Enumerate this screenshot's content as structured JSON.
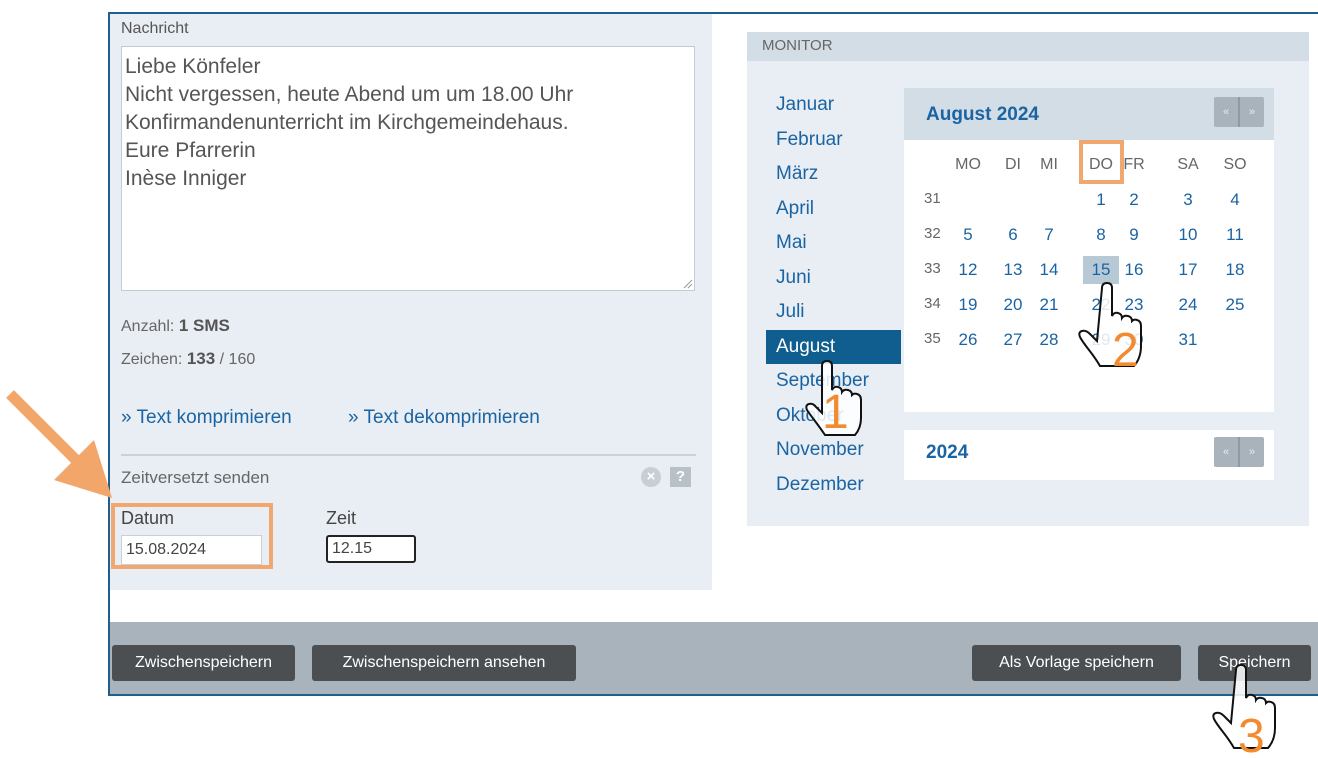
{
  "message": {
    "label": "Nachricht",
    "text": "Liebe Könfeler\nNicht vergessen, heute Abend um um 18.00 Uhr Konfirmandenunterricht im Kirchgemeindehaus.\nEure Pfarrerin\nInèse Inniger"
  },
  "stats": {
    "count_label": "Anzahl:",
    "count_value": "1 SMS",
    "chars_label": "Zeichen:",
    "chars_value": "133",
    "chars_max": "/ 160"
  },
  "links": {
    "compress": "» Text komprimieren",
    "decompress": "» Text dekomprimieren"
  },
  "deferred": {
    "title": "Zeitversetzt senden",
    "date_label": "Datum",
    "date_value": "15.08.2024",
    "time_label": "Zeit",
    "time_value": "12.15"
  },
  "monitor": {
    "title": "MONITOR",
    "months": [
      "Januar",
      "Februar",
      "März",
      "April",
      "Mai",
      "Juni",
      "Juli",
      "August",
      "September",
      "Oktober",
      "November",
      "Dezember"
    ],
    "active_month": "August",
    "calendar": {
      "title": "August 2024",
      "weekdays": [
        "MO",
        "DI",
        "MI",
        "DO",
        "FR",
        "SA",
        "SO"
      ],
      "highlighted_weekday": "DO",
      "weeks": [
        {
          "week": "31",
          "days": [
            "",
            "",
            "",
            "1",
            "2",
            "3",
            "4"
          ]
        },
        {
          "week": "32",
          "days": [
            "5",
            "6",
            "7",
            "8",
            "9",
            "10",
            "11"
          ]
        },
        {
          "week": "33",
          "days": [
            "12",
            "13",
            "14",
            "15",
            "16",
            "17",
            "18"
          ]
        },
        {
          "week": "34",
          "days": [
            "19",
            "20",
            "21",
            "22",
            "23",
            "24",
            "25"
          ]
        },
        {
          "week": "35",
          "days": [
            "26",
            "27",
            "28",
            "29",
            "30",
            "31",
            ""
          ]
        }
      ],
      "selected_day": "15"
    },
    "year": "2024",
    "prev": "«",
    "next": "»"
  },
  "buttons": {
    "save_draft": "Zwischenspeichern",
    "view_draft": "Zwischenspeichern ansehen",
    "save_template": "Als Vorlage speichern",
    "save": "Speichern"
  },
  "annotations": {
    "step1": "1",
    "step2": "2",
    "step3": "3",
    "accent": "#f28a30"
  }
}
